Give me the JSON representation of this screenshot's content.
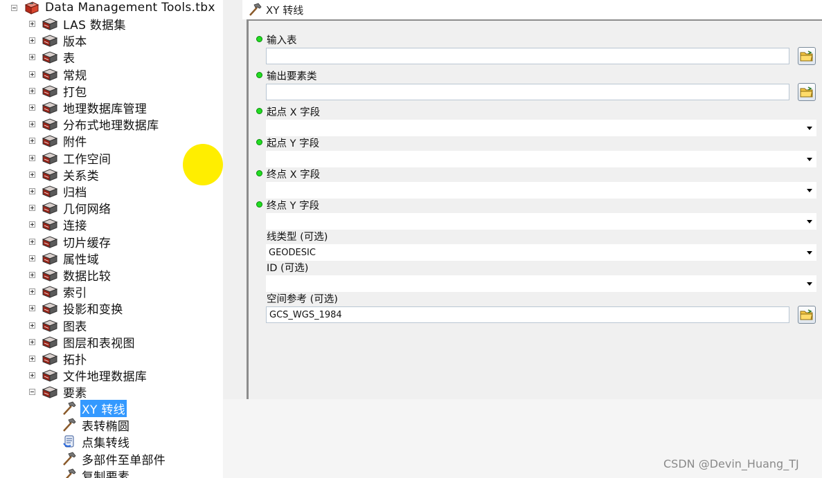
{
  "tree": {
    "root": {
      "label": "Data Management Tools.tbx",
      "expanded": true
    },
    "toolsets": [
      {
        "label": "LAS 数据集",
        "expanded": false
      },
      {
        "label": "版本",
        "expanded": false
      },
      {
        "label": "表",
        "expanded": false
      },
      {
        "label": "常规",
        "expanded": false
      },
      {
        "label": "打包",
        "expanded": false
      },
      {
        "label": "地理数据库管理",
        "expanded": false
      },
      {
        "label": "分布式地理数据库",
        "expanded": false
      },
      {
        "label": "附件",
        "expanded": false
      },
      {
        "label": "工作空间",
        "expanded": false
      },
      {
        "label": "关系类",
        "expanded": false
      },
      {
        "label": "归档",
        "expanded": false
      },
      {
        "label": "几何网络",
        "expanded": false
      },
      {
        "label": "连接",
        "expanded": false
      },
      {
        "label": "切片缓存",
        "expanded": false
      },
      {
        "label": "属性域",
        "expanded": false
      },
      {
        "label": "数据比较",
        "expanded": false
      },
      {
        "label": "索引",
        "expanded": false
      },
      {
        "label": "投影和变换",
        "expanded": false
      },
      {
        "label": "图表",
        "expanded": false
      },
      {
        "label": "图层和表视图",
        "expanded": false
      },
      {
        "label": "拓扑",
        "expanded": false
      },
      {
        "label": "文件地理数据库",
        "expanded": false
      },
      {
        "label": "要素",
        "expanded": true
      }
    ],
    "tools": [
      {
        "label": "XY 转线",
        "icon": "hammer-icon",
        "selected": true
      },
      {
        "label": "表转椭圆",
        "icon": "hammer-icon",
        "selected": false
      },
      {
        "label": "点集转线",
        "icon": "script-icon",
        "selected": false
      },
      {
        "label": "多部件至单部件",
        "icon": "hammer-icon",
        "selected": false
      },
      {
        "label": "复制要素",
        "icon": "hammer-icon",
        "selected": false
      }
    ]
  },
  "dialog": {
    "title": "XY 转线",
    "params": [
      {
        "label": "输入表",
        "required": true,
        "kind": "text",
        "value": "",
        "browse": true
      },
      {
        "label": "输出要素类",
        "required": true,
        "kind": "text",
        "value": "",
        "browse": true
      },
      {
        "label": "起点 X 字段",
        "required": true,
        "kind": "combo",
        "value": ""
      },
      {
        "label": "起点 Y 字段",
        "required": true,
        "kind": "combo",
        "value": ""
      },
      {
        "label": "终点 X 字段",
        "required": true,
        "kind": "combo",
        "value": ""
      },
      {
        "label": "终点 Y 字段",
        "required": true,
        "kind": "combo",
        "value": ""
      },
      {
        "label": "线类型 (可选)",
        "required": false,
        "kind": "combo",
        "value": "GEODESIC"
      },
      {
        "label": "ID (可选)",
        "required": false,
        "kind": "combo",
        "value": ""
      },
      {
        "label": "空间参考 (可选)",
        "required": false,
        "kind": "text",
        "value": "GCS_WGS_1984",
        "browse": true
      }
    ]
  },
  "colors": {
    "selection": "#3399ff",
    "required_dot": "#22dd22",
    "highlight_marker": "#ffee00"
  },
  "watermark": "CSDN @Devin_Huang_TJ"
}
